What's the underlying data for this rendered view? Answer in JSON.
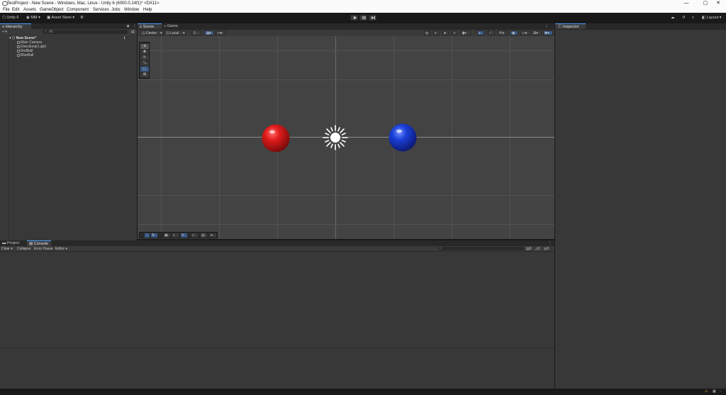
{
  "window": {
    "title": "TestProject - New Scene - Windows, Mac, Linux - Unity 6 (6000.0.24f1)* <DX11>",
    "controls": [
      "—",
      "▢",
      "✕"
    ]
  },
  "menubar": [
    "File",
    "Edit",
    "Assets",
    "GameObject",
    "Component",
    "Services",
    "Jobs",
    "Window",
    "Help"
  ],
  "toolbar": {
    "unity_label": "Unity 6",
    "account_label": "MM",
    "asset_store_label": "Asset Store",
    "layout_label": "Layout"
  },
  "hierarchy": {
    "tab": "Hierarchy",
    "search_placeholder": "All",
    "scene_name": "New Scene*",
    "items": [
      "Main Camera",
      "Directional Light",
      "RedBall",
      "BlueBall"
    ]
  },
  "scene_view": {
    "tabs": [
      "Scene",
      "Game"
    ],
    "pivot_label": "Center",
    "space_label": "Local",
    "snap_value": "1"
  },
  "inspector": {
    "tab": "Inspector"
  },
  "bottom": {
    "tabs": [
      "Project",
      "Console"
    ],
    "console_buttons": [
      "Clear",
      "Collapse",
      "Error Pause",
      "Editor"
    ],
    "counts": [
      "0",
      "0",
      "0"
    ]
  },
  "colors": {
    "red_ball": "#e01b1b",
    "blue_ball": "#1a3fd8",
    "accent": "#4aa0ff",
    "panel_bg": "#383838",
    "scene_bg": "#434343"
  },
  "icons": {
    "sun": "directional-light-gizmo",
    "play": "play-icon",
    "pause": "pause-icon",
    "step": "step-icon"
  }
}
